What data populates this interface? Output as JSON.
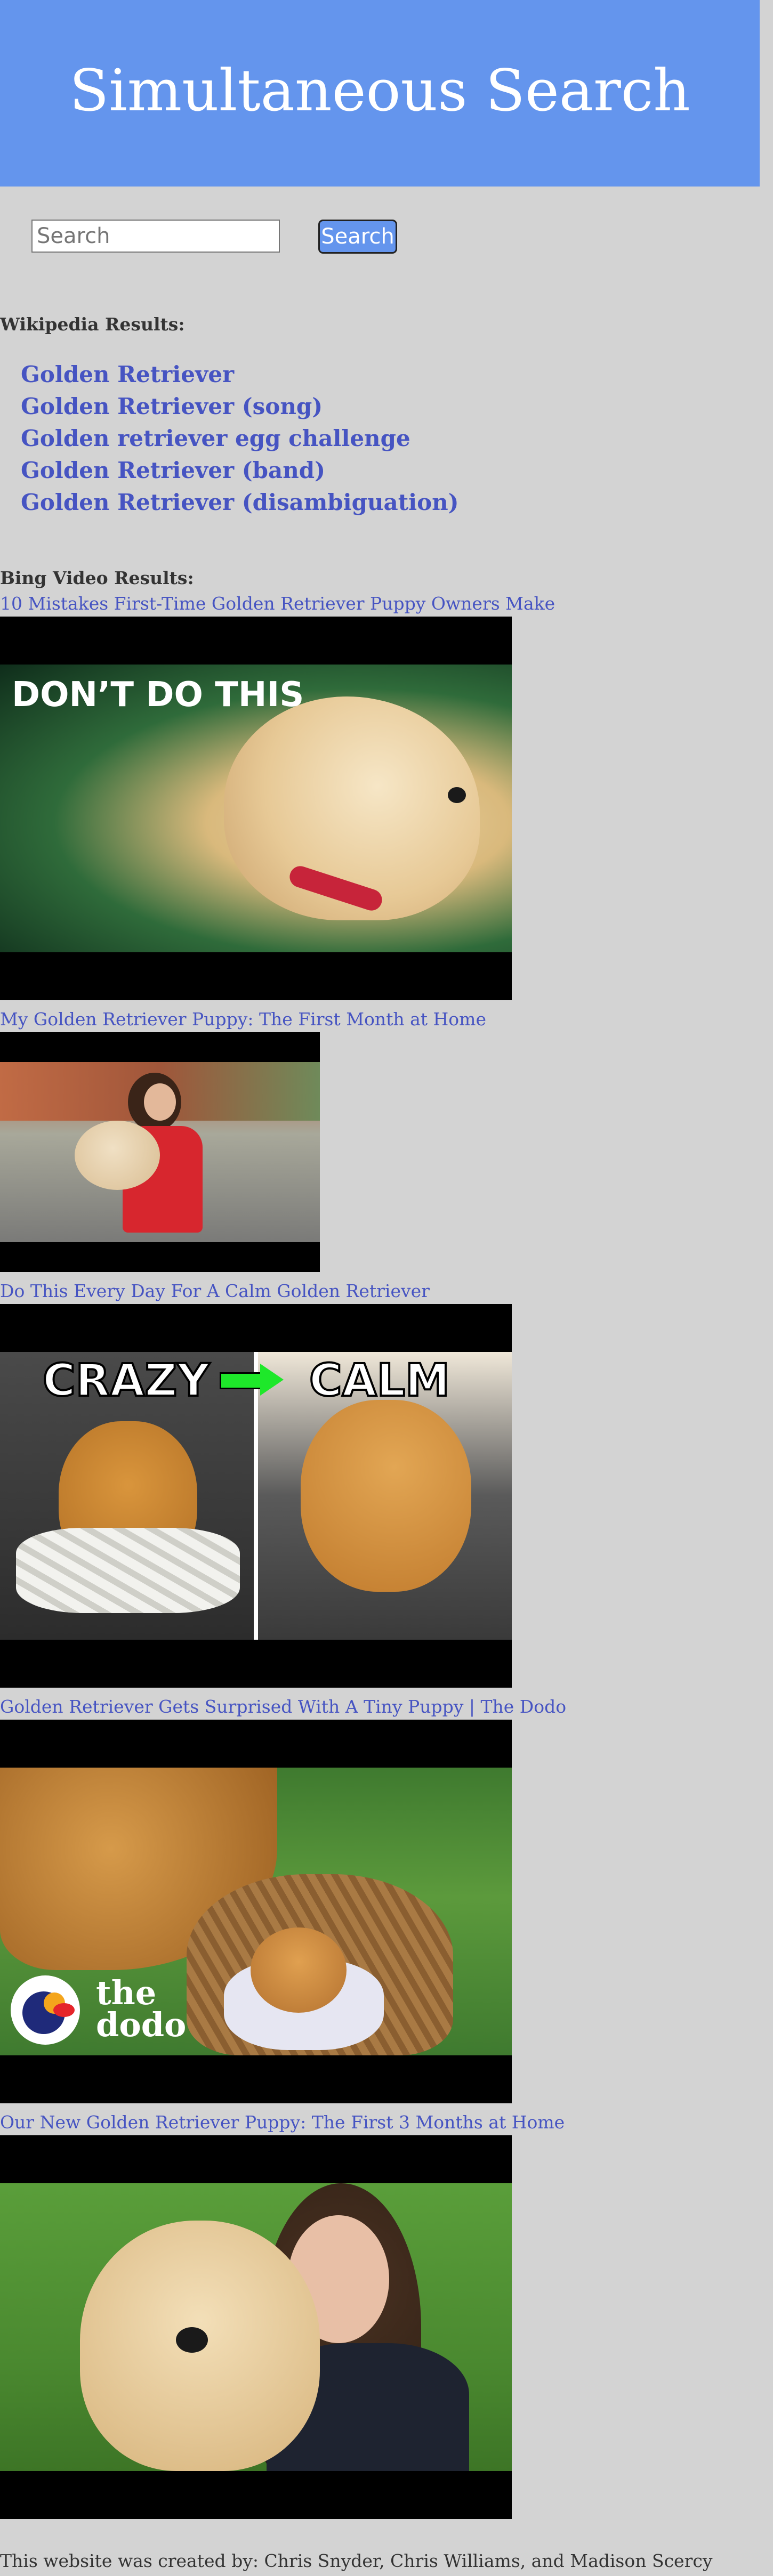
{
  "header": {
    "title": "Simultaneous Search"
  },
  "search": {
    "placeholder": "Search",
    "value": "",
    "button_label": "Search"
  },
  "wikipedia": {
    "heading": "Wikipedia Results:",
    "results": [
      "Golden Retriever",
      "Golden Retriever (song)",
      "Golden retriever egg challenge",
      "Golden Retriever (band)",
      "Golden Retriever (disambiguation)"
    ]
  },
  "bing": {
    "heading": "Bing Video Results:",
    "videos": [
      {
        "title": "10 Mistakes First-Time Golden Retriever Puppy Owners Make",
        "overlay": "DON’T DO THIS"
      },
      {
        "title": "My Golden Retriever Puppy: The First Month at Home"
      },
      {
        "title": "Do This Every Day For A Calm Golden Retriever",
        "overlay_left": "CRAZY",
        "overlay_right": "CALM"
      },
      {
        "title": "Golden Retriever Gets Surprised With A Tiny Puppy | The Dodo",
        "logo_line1": "the",
        "logo_line2": "dodo"
      },
      {
        "title": "Our New Golden Retriever Puppy: The First 3 Months at Home"
      }
    ]
  },
  "footer": {
    "credits": "This website was created by: Chris Snyder, Chris Williams, and Madison Scercy"
  },
  "colors": {
    "header_bg": "#6495ed",
    "page_bg": "#d3d3d3",
    "link": "#4654c2",
    "accent_green": "#1ee82a"
  }
}
